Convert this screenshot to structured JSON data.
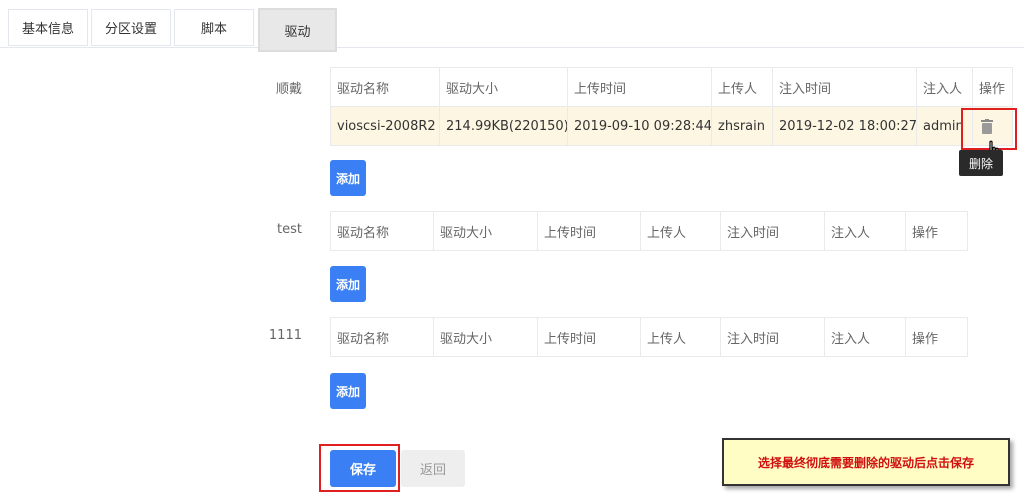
{
  "tabs": [
    {
      "label": "基本信息"
    },
    {
      "label": "分区设置"
    },
    {
      "label": "脚本"
    },
    {
      "label": "驱动"
    }
  ],
  "columns": [
    "驱动名称",
    "驱动大小",
    "上传时间",
    "上传人",
    "注入时间",
    "注入人",
    "操作"
  ],
  "groups": [
    {
      "name": "顺戴",
      "rows": [
        {
          "name": "vioscsi-2008R2",
          "size": "214.99KB(220150)",
          "upload_time": "2019-09-10 09:28:44",
          "uploader": "zhsrain",
          "inject_time": "2019-12-02 18:00:27",
          "injector": "admin"
        }
      ],
      "add_label": "添加"
    },
    {
      "name": "test",
      "rows": [],
      "add_label": "添加"
    },
    {
      "name": "1111",
      "rows": [],
      "add_label": "添加"
    }
  ],
  "tooltip": "删除",
  "icons": {
    "delete": "trash-icon",
    "cursor": "hand-cursor-icon"
  },
  "actions": {
    "save": "保存",
    "back": "返回"
  },
  "note": "选择最终彻底需要删除的驱动后点击保存",
  "colors": {
    "primary": "#3a7ff3",
    "highlight": "#e02020",
    "note_bg": "#fffdc4",
    "note_text": "#d01010"
  }
}
